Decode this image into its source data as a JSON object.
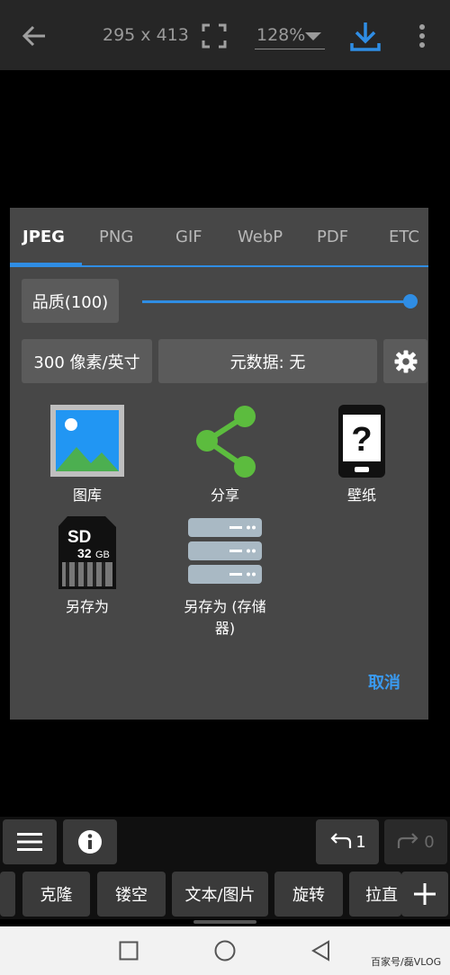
{
  "topbar": {
    "dimensions": "295 x 413",
    "zoom": "128%"
  },
  "dialog": {
    "tabs": [
      {
        "label": "JPEG"
      },
      {
        "label": "PNG"
      },
      {
        "label": "GIF"
      },
      {
        "label": "WebP"
      },
      {
        "label": "PDF"
      },
      {
        "label": "ETC"
      }
    ],
    "quality_label": "品质(100)",
    "quality_value": 100,
    "dpi_label": "300 像素/英寸",
    "metadata_label": "元数据: 无",
    "targets": [
      {
        "label": "图库",
        "icon": "gallery-icon"
      },
      {
        "label": "分享",
        "icon": "share-icon"
      },
      {
        "label": "壁纸",
        "icon": "wallpaper-icon"
      },
      {
        "label": "另存为",
        "icon": "sd-card-icon"
      },
      {
        "label": "另存为 (存储器)",
        "icon": "storage-icon"
      }
    ],
    "sd_text": "SD",
    "sd_size": "32",
    "sd_unit": "GB",
    "wallpaper_glyph": "?",
    "cancel_label": "取消"
  },
  "toolbar": {
    "undo_count": "1",
    "redo_count": "0",
    "tools": [
      "克隆",
      "镂空",
      "文本/图片",
      "旋转",
      "拉直"
    ]
  },
  "watermark": "百家号/磊VLOG",
  "colors": {
    "accent": "#2f8de4",
    "share": "#5cbc3e",
    "dialog_bg": "#474747"
  }
}
